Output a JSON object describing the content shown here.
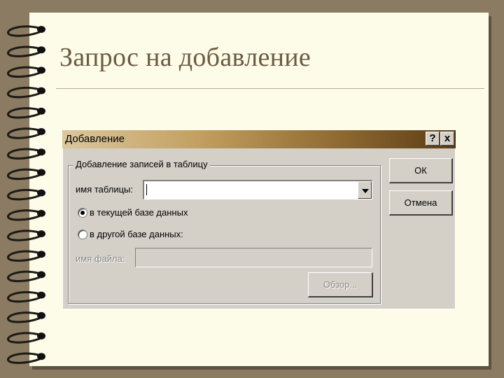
{
  "slide": {
    "title": "Запрос на добавление"
  },
  "dialog": {
    "title": "Добавление",
    "help_label": "?",
    "close_label": "x",
    "group_label": "Добавление записей в таблицу",
    "table_name_label": "имя таблицы:",
    "table_name_value": "",
    "radio_current_label": "в текущей базе данных",
    "radio_current_checked": true,
    "radio_other_label": "в другой базе данных:",
    "radio_other_checked": false,
    "file_name_label": "имя файла:",
    "file_name_value": "",
    "browse_label": "Обзор...",
    "ok_label": "ОК",
    "cancel_label": "Отмена"
  },
  "colors": {
    "background": "#8b7b62",
    "paper": "#fdfce8",
    "title_text": "#6b5a40",
    "dialog_face": "#d4d0c8",
    "titlebar_start": "#dcc79c",
    "titlebar_end": "#5a3b14"
  }
}
